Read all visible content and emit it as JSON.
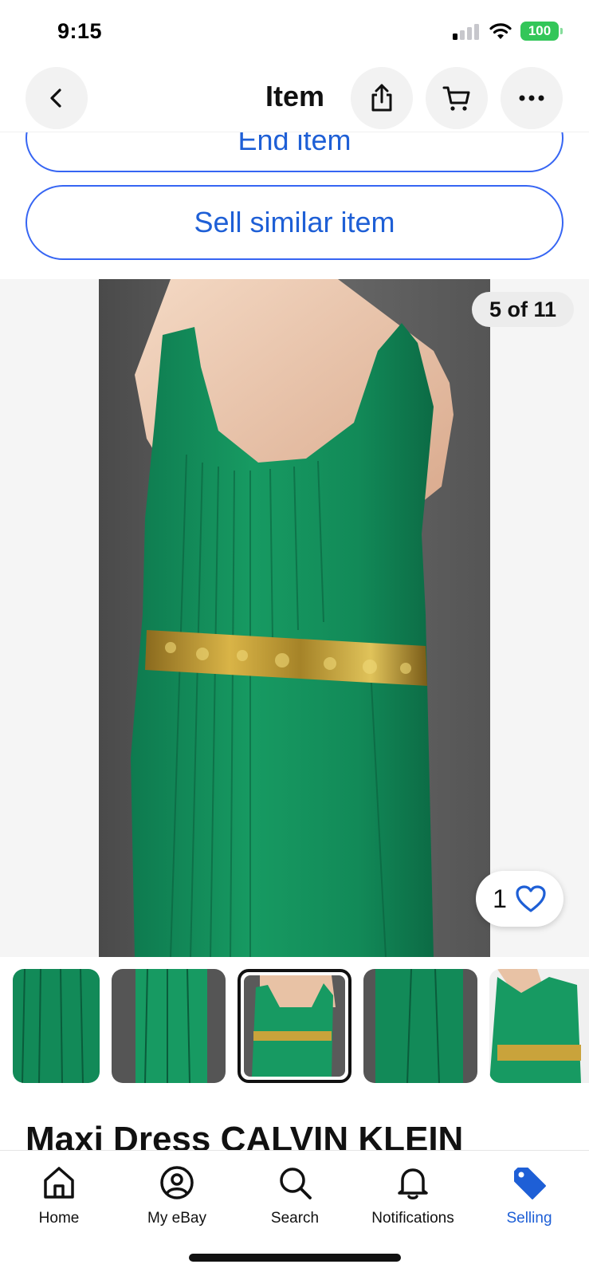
{
  "status_bar": {
    "time": "9:15",
    "battery": "100"
  },
  "header": {
    "title": "Item",
    "back_icon": "chevron-left-icon",
    "share_icon": "share-icon",
    "cart_icon": "cart-icon",
    "more_icon": "more-icon"
  },
  "actions": {
    "end_item_label": "End item",
    "sell_similar_label": "Sell similar item"
  },
  "gallery": {
    "counter": "5 of 11",
    "watch_count": "1",
    "selected_thumb_index": 2
  },
  "item": {
    "title": "Maxi Dress CALVIN KLEIN"
  },
  "nav": {
    "items": [
      {
        "label": "Home",
        "icon": "home-icon"
      },
      {
        "label": "My eBay",
        "icon": "user-icon"
      },
      {
        "label": "Search",
        "icon": "search-icon"
      },
      {
        "label": "Notifications",
        "icon": "bell-icon"
      },
      {
        "label": "Selling",
        "icon": "tag-icon"
      }
    ],
    "active": "Selling"
  },
  "colors": {
    "accent": "#1e5fd6",
    "dress": "#128a5a",
    "belt": "#b8962e"
  }
}
